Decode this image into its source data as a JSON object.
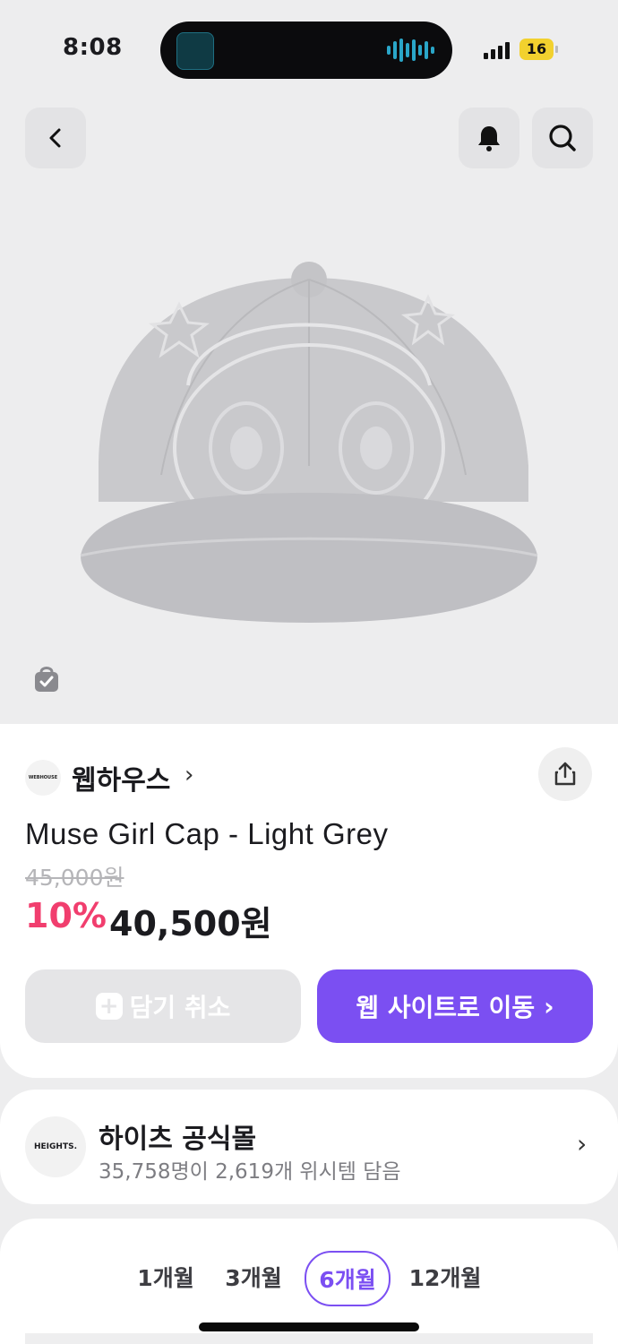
{
  "status_bar": {
    "time": "8:08",
    "battery": "16"
  },
  "header": {
    "back_icon": "chevron-left-icon",
    "bell_icon": "bell-icon",
    "search_icon": "search-icon"
  },
  "product": {
    "brand": "웹하우스",
    "brand_logo_text": "WEBHOUSE",
    "title": "Muse Girl Cap - Light Grey",
    "original_price": "45,000원",
    "discount": "10%",
    "price": "40,500원",
    "save_button": "담기 취소",
    "website_button": "웹 사이트로 이동",
    "accent": "#7b4ff2",
    "discount_color": "#f13e6e"
  },
  "shop": {
    "logo_text": "HEIGHTS.",
    "name": "하이츠 공식몰",
    "stats": "35,758명이 2,619개 위시템 담음"
  },
  "period_tabs": {
    "items": [
      "1개월",
      "3개월",
      "6개월",
      "12개월"
    ],
    "selected": "6개월"
  }
}
